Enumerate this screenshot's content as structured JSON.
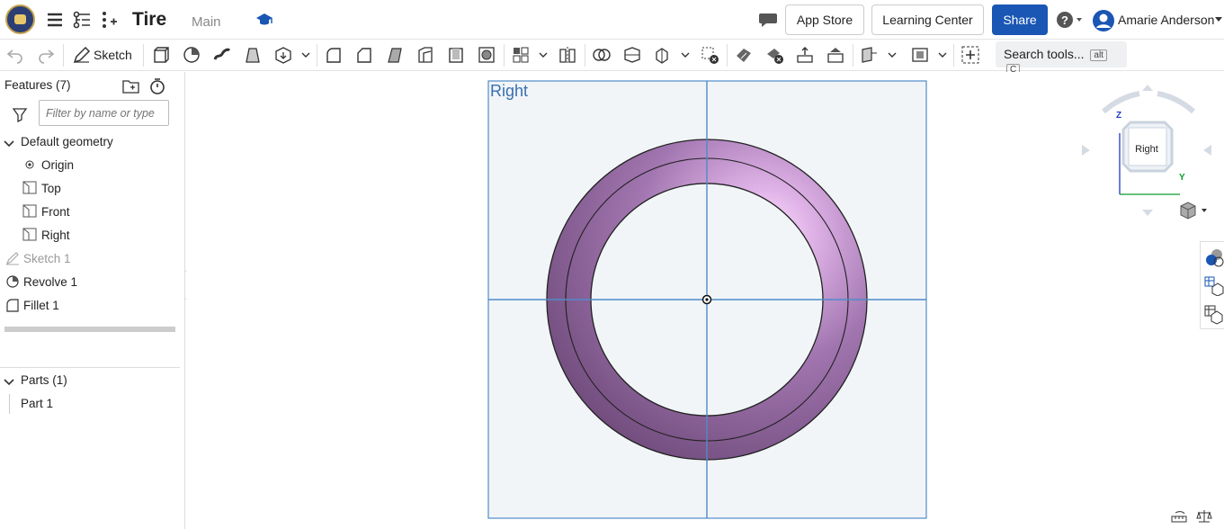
{
  "header": {
    "doc_title": "Tire",
    "branch": "Main",
    "app_store": "App Store",
    "learning_center": "Learning Center",
    "share": "Share",
    "user_name": "Amarie Anderson"
  },
  "toolbar": {
    "sketch_label": "Sketch",
    "search_label": "Search tools...",
    "search_key1": "alt",
    "search_key2": "C"
  },
  "features": {
    "title": "Features (7)",
    "filter_placeholder": "Filter by name or type",
    "default_geometry": "Default geometry",
    "items": [
      {
        "label": "Origin"
      },
      {
        "label": "Top"
      },
      {
        "label": "Front"
      },
      {
        "label": "Right"
      },
      {
        "label": "Sketch 1"
      },
      {
        "label": "Revolve 1"
      },
      {
        "label": "Fillet 1"
      }
    ]
  },
  "parts": {
    "title": "Parts (1)",
    "items": [
      {
        "label": "Part 1"
      }
    ]
  },
  "viewport": {
    "plane_label": "Right",
    "viewcube_label": "Right",
    "axis_z": "Z",
    "axis_y": "Y"
  },
  "colors": {
    "accent": "#1a56b4",
    "tire": "#9a6aa8",
    "plane_fill": "#f1f5f8",
    "plane_line": "#4f8bc9"
  }
}
